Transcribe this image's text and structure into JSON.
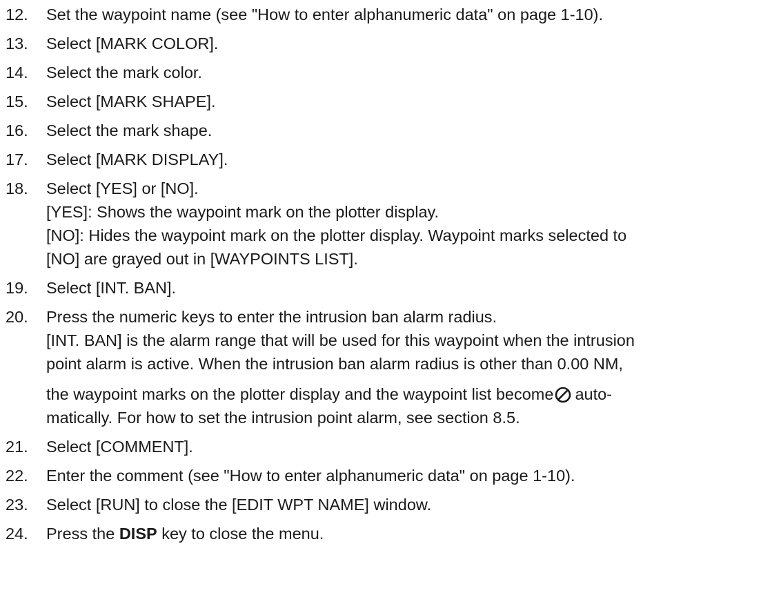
{
  "steps": [
    {
      "num": "12.",
      "text": "Set the waypoint name (see \"How to enter alphanumeric data\" on page 1-10)."
    },
    {
      "num": "13.",
      "text": "Select [MARK COLOR]."
    },
    {
      "num": "14.",
      "text": "Select the mark color."
    },
    {
      "num": "15.",
      "text": "Select [MARK SHAPE]."
    },
    {
      "num": "16.",
      "text": "Select the mark shape."
    },
    {
      "num": "17.",
      "text": "Select [MARK DISPLAY]."
    },
    {
      "num": "18.",
      "text": "Select [YES] or [NO].",
      "details": [
        "[YES]: Shows the waypoint mark on the plotter display.",
        "[NO]: Hides the waypoint mark on the plotter display. Waypoint marks selected to",
        "[NO] are grayed out in [WAYPOINTS LIST]."
      ]
    },
    {
      "num": "19.",
      "text": "Select [INT. BAN]."
    },
    {
      "num": "20.",
      "text": "Press the numeric keys to enter the intrusion ban alarm radius.",
      "details": [
        "[INT. BAN] is the alarm range that will be used for this waypoint when the intrusion",
        "point alarm is active. When the intrusion ban alarm radius is other than 0.00 NM,"
      ],
      "detail_icon_before": "the waypoint marks on the plotter display and the waypoint list become",
      "icon": "prohibited-circle-icon",
      "detail_icon_after": "auto-",
      "detail_last": "matically. For how to set the intrusion point alarm, see section 8.5."
    },
    {
      "num": "21.",
      "text": "Select [COMMENT]."
    },
    {
      "num": "22.",
      "text": "Enter the comment (see \"How to enter alphanumeric data\" on page 1-10)."
    },
    {
      "num": "23.",
      "text": "Select [RUN] to close the [EDIT WPT NAME] window."
    },
    {
      "num": "24.",
      "text_before": "Press the",
      "key": "DISP",
      "text_after": "key to close the menu."
    }
  ]
}
